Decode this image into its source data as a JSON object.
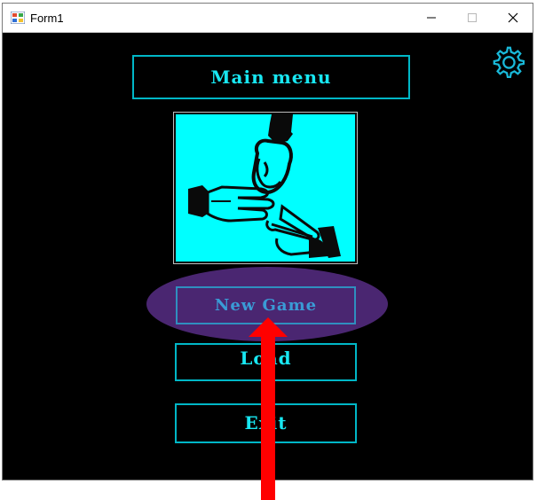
{
  "window": {
    "title": "Form1",
    "app_icon": "windows-form-icon",
    "controls": [
      "minimize-icon",
      "maximize-icon",
      "close-icon"
    ]
  },
  "main": {
    "settings_icon": "gear-icon",
    "menu_title": "Main menu",
    "image": "rock-paper-scissors-hands",
    "buttons": {
      "new_game": "New Game",
      "load": "Load",
      "exit": "Exit"
    },
    "annotations": {
      "highlight": "ellipse",
      "pointer": "red-arrow"
    }
  },
  "colors": {
    "background": "#000000",
    "accent": "#18e7f2",
    "image_background": "#00ffff",
    "highlight": "#4a2671",
    "new_game_text": "#3a9bd6",
    "arrow": "#ff0000"
  }
}
